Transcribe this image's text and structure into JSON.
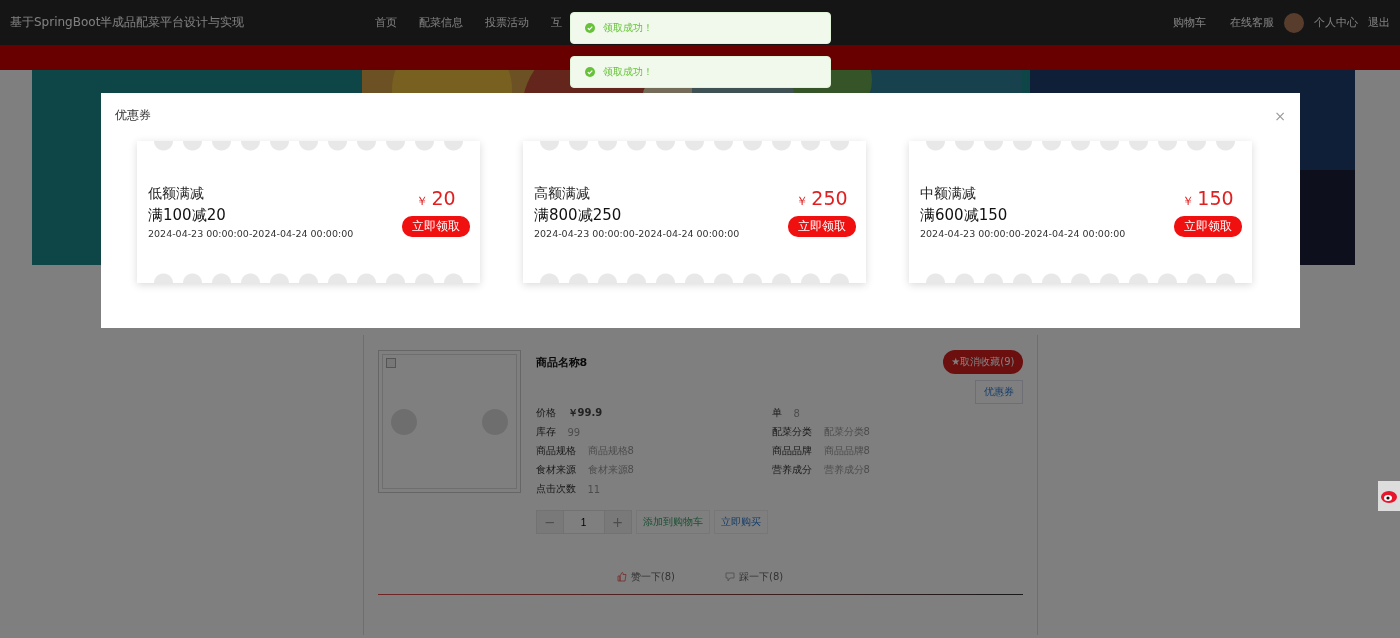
{
  "header": {
    "title": "基于SpringBoot半成品配菜平台设计与实现",
    "nav": [
      {
        "label": "首页"
      },
      {
        "label": "配菜信息"
      },
      {
        "label": "投票活动"
      },
      {
        "label": "互"
      }
    ],
    "links": [
      {
        "label": "购物车"
      },
      {
        "label": "在线客服"
      }
    ],
    "user": {
      "label": "个人中心"
    },
    "logout": "退出"
  },
  "toasts": [
    {
      "text": "领取成功！"
    },
    {
      "text": "领取成功！"
    }
  ],
  "product": {
    "name": "商品名称8",
    "favorite_button": "★取消收藏(9)",
    "coupon_button": "优惠券",
    "price": {
      "label": "价格",
      "value": "￥99.9"
    },
    "left_fields": [
      {
        "label": "库存",
        "value": "99"
      },
      {
        "label": "商品规格",
        "value": "商品规格8"
      },
      {
        "label": "食材来源",
        "value": "食材来源8"
      },
      {
        "label": "点击次数",
        "value": "11"
      }
    ],
    "right_fields": [
      {
        "label": "单",
        "value": "8"
      },
      {
        "label": "配菜分类",
        "value": "配菜分类8"
      },
      {
        "label": "商品品牌",
        "value": "商品品牌8"
      },
      {
        "label": "营养成分",
        "value": "营养成分8"
      }
    ],
    "quantity": {
      "minus": "−",
      "value": "1",
      "plus": "+"
    },
    "add_to_cart": "添加到购物车",
    "buy_now": "立即购买",
    "like": "赞一下(8)",
    "dislike": "踩一下(8)"
  },
  "dialog": {
    "title": "优惠券",
    "close": "×",
    "coupons": [
      {
        "name": "低额满减",
        "rule": "满100减20",
        "period": "2024-04-23 00:00:00-2024-04-24 00:00:00",
        "currency": "￥",
        "amount": "20",
        "button": "立即领取"
      },
      {
        "name": "高额满减",
        "rule": "满800减250",
        "period": "2024-04-23 00:00:00-2024-04-24 00:00:00",
        "currency": "￥",
        "amount": "250",
        "button": "立即领取"
      },
      {
        "name": "中额满减",
        "rule": "满600减150",
        "period": "2024-04-23 00:00:00-2024-04-24 00:00:00",
        "currency": "￥",
        "amount": "150",
        "button": "立即领取"
      }
    ]
  }
}
